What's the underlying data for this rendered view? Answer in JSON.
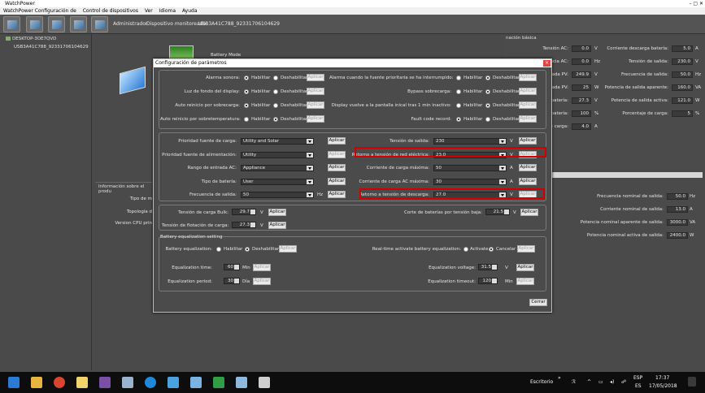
{
  "app": {
    "title": "WatchPower",
    "menu": [
      "WatchPower Configuración de",
      "Control de dispositivos",
      "Ver",
      "Idioma",
      "Ayuda"
    ],
    "user_label": "Administrador",
    "monitored_label": "Dispositivo monitoreado:",
    "monitored_device": "USB3A41C788_92331706104629"
  },
  "tree": {
    "root": "DESKTOP-3OE7QVD",
    "child": "USB3A41C788_92331706104629"
  },
  "inverter_panel": {
    "battery_mode": "Battery Mode"
  },
  "right_panel": {
    "title": "nación básica",
    "left_rows": [
      {
        "label": "Tensión AC:",
        "value": "0.0",
        "unit": "V"
      },
      {
        "label": "ncia AC:",
        "value": "0.0",
        "unit": "Hz"
      },
      {
        "label": "ada PV:",
        "value": "249.9",
        "unit": "V"
      },
      {
        "label": "ada PV:",
        "value": "25",
        "unit": "W"
      },
      {
        "label": "batería:",
        "value": "27.3",
        "unit": "V"
      },
      {
        "label": "batería:",
        "value": "100",
        "unit": "%"
      },
      {
        "label": "e carga:",
        "value": "4.0",
        "unit": "A"
      }
    ],
    "right_rows": [
      {
        "label": "Corriente descarga batería:",
        "value": "5.0",
        "unit": "A"
      },
      {
        "label": "Tensión de salida:",
        "value": "230.0",
        "unit": "V"
      },
      {
        "label": "Frecuencia de salida:",
        "value": "50.0",
        "unit": "Hz"
      },
      {
        "label": "Potencia de salida aparente:",
        "value": "160.0",
        "unit": "VA"
      },
      {
        "label": "Potencia de salida activa:",
        "value": "121.0",
        "unit": "W"
      },
      {
        "label": "Porcentaje de carga:",
        "value": "5",
        "unit": "%"
      }
    ]
  },
  "lower_panel": {
    "title": "Información sobre el produ",
    "left_labels": [
      "Tipo de m",
      "Topología d",
      "Version CPU prin"
    ],
    "right_rows": [
      {
        "label": "Frecuencia nominal de salida:",
        "value": "50.0",
        "unit": "Hz"
      },
      {
        "label": "Corriente nominal de salida:",
        "value": "13.0",
        "unit": "A"
      },
      {
        "label": "Potencia nominal aparente de salida:",
        "value": "3000.0",
        "unit": "VA"
      },
      {
        "label": "Potencia nominal activa de salida:",
        "value": "2400.0",
        "unit": "W"
      }
    ]
  },
  "dialog": {
    "title": "Configuración de parámetros",
    "close": "×",
    "radio_enable": "Habilitar",
    "radio_disable": "Deshabilitar",
    "apply": "Aplicar",
    "toggles_left": [
      {
        "label": "Alarma sonora:",
        "enabled": true
      },
      {
        "label": "Luz de fondo del display:",
        "enabled": true
      },
      {
        "label": "Auto reinicio por sobrecarga:",
        "enabled": true
      },
      {
        "label": "Auto reinicio por sobretemperatura:",
        "enabled": false
      }
    ],
    "toggles_right": [
      {
        "label": "Alarma cuando la fuente prioritaria se ha interrumpido:",
        "enabled": false
      },
      {
        "label": "Bypass sobrecarga:",
        "enabled": false
      },
      {
        "label": "Display vuelve a la pantalla inical tras 1 min inactivo:",
        "enabled": false
      },
      {
        "label": "Fault code record:",
        "enabled": true
      }
    ],
    "selects_left": [
      {
        "label": "Prioridad fuente de carga:",
        "value": "Utility and Solar",
        "unit": ""
      },
      {
        "label": "Prioridad fuente de alimentación:",
        "value": "Utility",
        "unit": ""
      },
      {
        "label": "Rango de entrada AC:",
        "value": "Appliance",
        "unit": ""
      },
      {
        "label": "Tipo de batería:",
        "value": "User",
        "unit": ""
      },
      {
        "label": "Frecuencia de salida:",
        "value": "50",
        "unit": "Hz"
      }
    ],
    "selects_right": [
      {
        "label": "Tensión de salida:",
        "value": "230",
        "unit": "V"
      },
      {
        "label": "Retorno a tensión de red eléctrica:",
        "value": "23.0",
        "unit": "V"
      },
      {
        "label": "Corriente de carga máxima:",
        "value": "50",
        "unit": "A"
      },
      {
        "label": "Corriente de carga AC máxima:",
        "value": "30",
        "unit": "A"
      },
      {
        "label": "Retorno a tensión de descarga:",
        "value": "27.0",
        "unit": "V"
      }
    ],
    "bulk_label": "Tensión de carga Bulk:",
    "bulk_value": "29.7",
    "float_label": "Tensión de flotación de carga:",
    "float_value": "27.3",
    "cutoff_label": "Corte de baterías por tensión baja:",
    "cutoff_value": "21.5",
    "volt_unit": "V",
    "eq_title": "Battery equalization setting",
    "eq_label": "Battery equalization:",
    "rt_label": "Real-time activate battery equalization:",
    "rt_activate": "Activate",
    "rt_cancel": "Cancelar",
    "eq_time_label": "Equalization time:",
    "eq_time_value": "60",
    "eq_time_unit": "Min",
    "eq_period_label": "Equalization period:",
    "eq_period_value": "30",
    "eq_period_unit": "Día",
    "eq_voltage_label": "Equalization voltage:",
    "eq_voltage_value": "31.5",
    "eq_timeout_label": "Equalization timeout:",
    "eq_timeout_value": "120",
    "close_button": "Cerrar"
  },
  "taskbar": {
    "desktop_label": "Escritorio",
    "lang": "ESP",
    "lang2": "ES",
    "time": "17:37",
    "date": "17/05/2018"
  }
}
